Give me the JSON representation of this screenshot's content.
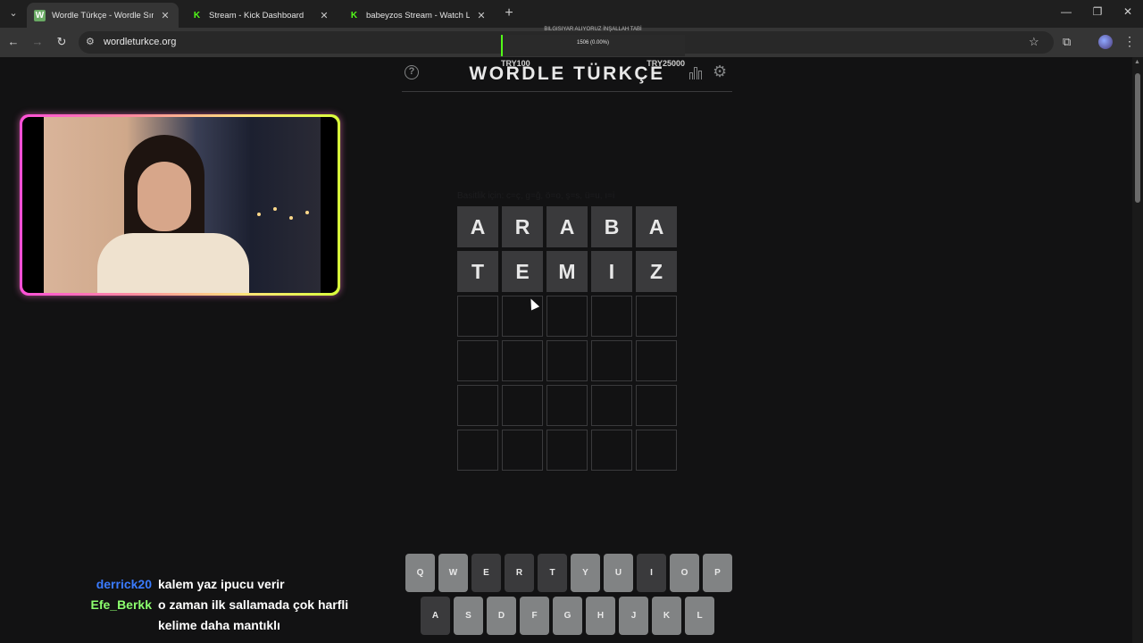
{
  "browser": {
    "tabs": [
      {
        "title": "Wordle Türkçe - Wordle Sınırsız",
        "favicon_letter": "W",
        "favicon_color": "#6aaa64",
        "active": true
      },
      {
        "title": "Stream - Kick Dashboard",
        "favicon_letter": "K",
        "favicon_color": "#53fc18",
        "active": false
      },
      {
        "title": "babeyzos Stream - Watch Live o",
        "favicon_letter": "K",
        "favicon_color": "#53fc18",
        "active": false
      }
    ],
    "url": "wordleturkce.org"
  },
  "donation": {
    "title": "BILGISIYAR ALIYORUZ İNŞALLAH TABİ",
    "progress": "1506 (0.00%)",
    "min_label": "TRY100",
    "max_label": "TRY25000"
  },
  "game": {
    "title": "WORDLE TÜRKÇE",
    "hint": "Basitlik için: c=ç, g=ğ, ö=o, ş=s, ü=u, ı=i",
    "rows": [
      [
        "A",
        "R",
        "A",
        "B",
        "A"
      ],
      [
        "T",
        "E",
        "M",
        "I",
        "Z"
      ],
      [
        "",
        "",
        "",
        "",
        ""
      ],
      [
        "",
        "",
        "",
        "",
        ""
      ],
      [
        "",
        "",
        "",
        "",
        ""
      ],
      [
        "",
        "",
        "",
        "",
        ""
      ]
    ]
  },
  "keyboard": {
    "row1": [
      {
        "k": "Q",
        "state": "normal"
      },
      {
        "k": "W",
        "state": "normal"
      },
      {
        "k": "E",
        "state": "absent"
      },
      {
        "k": "R",
        "state": "absent"
      },
      {
        "k": "T",
        "state": "absent"
      },
      {
        "k": "Y",
        "state": "normal"
      },
      {
        "k": "U",
        "state": "normal"
      },
      {
        "k": "I",
        "state": "absent"
      },
      {
        "k": "O",
        "state": "normal"
      },
      {
        "k": "P",
        "state": "normal"
      }
    ],
    "row2": [
      {
        "k": "A",
        "state": "absent"
      },
      {
        "k": "S",
        "state": "normal"
      },
      {
        "k": "D",
        "state": "normal"
      },
      {
        "k": "F",
        "state": "normal"
      },
      {
        "k": "G",
        "state": "normal"
      },
      {
        "k": "H",
        "state": "normal"
      },
      {
        "k": "J",
        "state": "normal"
      },
      {
        "k": "K",
        "state": "normal"
      },
      {
        "k": "L",
        "state": "normal"
      }
    ]
  },
  "chat": [
    {
      "user": "derrick20",
      "color": "#3a7bff",
      "message": "kalem yaz ipucu verir"
    },
    {
      "user": "Efe_Berkk",
      "color": "#8cff6e",
      "message": "o zaman ilk sallamada çok harfli"
    },
    {
      "user": "",
      "color": "#ffffff",
      "message": "kelime daha mantıklı"
    }
  ]
}
